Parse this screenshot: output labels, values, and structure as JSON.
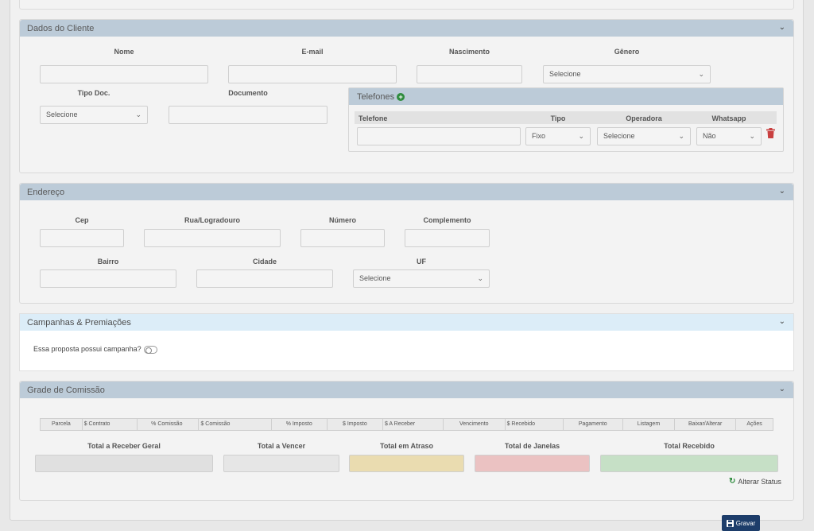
{
  "dados_cliente": {
    "title": "Dados do Cliente",
    "nome_label": "Nome",
    "email_label": "E-mail",
    "nascimento_label": "Nascimento",
    "genero_label": "Gênero",
    "genero_value": "Selecione",
    "tipo_doc_label": "Tipo Doc.",
    "tipo_doc_value": "Selecione",
    "documento_label": "Documento",
    "telefones": {
      "title": "Telefones",
      "columns": [
        "Telefone",
        "Tipo",
        "Operadora",
        "Whatsapp"
      ],
      "tipo_value": "Fixo",
      "operadora_value": "Selecione",
      "whatsapp_value": "Não"
    }
  },
  "endereco": {
    "title": "Endereço",
    "cep_label": "Cep",
    "rua_label": "Rua/Logradouro",
    "numero_label": "Número",
    "complemento_label": "Complemento",
    "bairro_label": "Bairro",
    "cidade_label": "Cidade",
    "uf_label": "UF",
    "uf_value": "Selecione"
  },
  "campanhas": {
    "title": "Campanhas & Premiações",
    "question": "Essa proposta possui campanha?"
  },
  "grade": {
    "title": "Grade de Comissão",
    "columns": [
      "Parcela",
      "$ Contrato",
      "% Comissão",
      "$ Comissão",
      "% Imposto",
      "$ Imposto",
      "$ A Receber",
      "Vencimento",
      "$ Recebido",
      "Pagamento",
      "Listagem",
      "Baixar/Alterar",
      "Ações"
    ],
    "totals": [
      "Total a Receber Geral",
      "Total a Vencer",
      "Total em Atraso",
      "Total de Janelas",
      "Total Recebido"
    ],
    "alterar_status": "Alterar Status"
  },
  "gravar_label": "Gravar",
  "colors": {
    "panel_head": "#bccbd8",
    "highlight_head": "#dcedf8",
    "total_atraso": "#eadcb0",
    "total_janelas": "#ebc2c2",
    "total_recebido": "#c6e0c6",
    "gravar_button": "#1d3d6a"
  },
  "icons": [
    "chevron-down-icon",
    "plus-circle-icon",
    "trash-icon",
    "refresh-icon",
    "save-icon"
  ]
}
